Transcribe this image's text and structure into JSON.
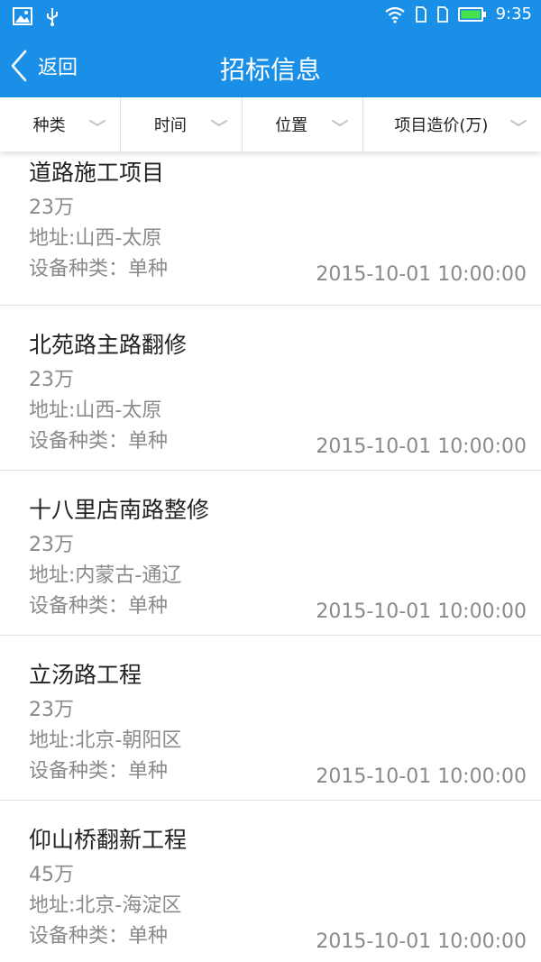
{
  "status_bar": {
    "time": "9:35",
    "icons": [
      "image-icon",
      "usb-icon",
      "wifi-icon",
      "sim1-icon",
      "sim2-icon",
      "battery-icon"
    ]
  },
  "app_bar": {
    "back_label": "返回",
    "title": "招标信息"
  },
  "filters": [
    {
      "label": "种类"
    },
    {
      "label": "时间"
    },
    {
      "label": "位置"
    },
    {
      "label": "项目造价(万)"
    }
  ],
  "projects": [
    {
      "title": "道路施工项目",
      "price": "23万",
      "address": "地址:山西-太原",
      "equipment": "设备种类：单种",
      "time": "2015-10-01 10:00:00"
    },
    {
      "title": "北苑路主路翻修",
      "price": "23万",
      "address": "地址:山西-太原",
      "equipment": "设备种类：单种",
      "time": "2015-10-01 10:00:00"
    },
    {
      "title": "十八里店南路整修",
      "price": "23万",
      "address": "地址:内蒙古-通辽",
      "equipment": "设备种类：单种",
      "time": "2015-10-01 10:00:00"
    },
    {
      "title": "立汤路工程",
      "price": "23万",
      "address": "地址:北京-朝阳区",
      "equipment": "设备种类：单种",
      "time": "2015-10-01 10:00:00"
    },
    {
      "title": "仰山桥翻新工程",
      "price": "45万",
      "address": "地址:北京-海淀区",
      "equipment": "设备种类：单种",
      "time": "2015-10-01 10:00:00"
    }
  ],
  "colors": {
    "primary": "#1a8fe8",
    "text_dark": "#222222",
    "text_gray": "#8a8a8a",
    "divider": "#e1e1e1"
  }
}
